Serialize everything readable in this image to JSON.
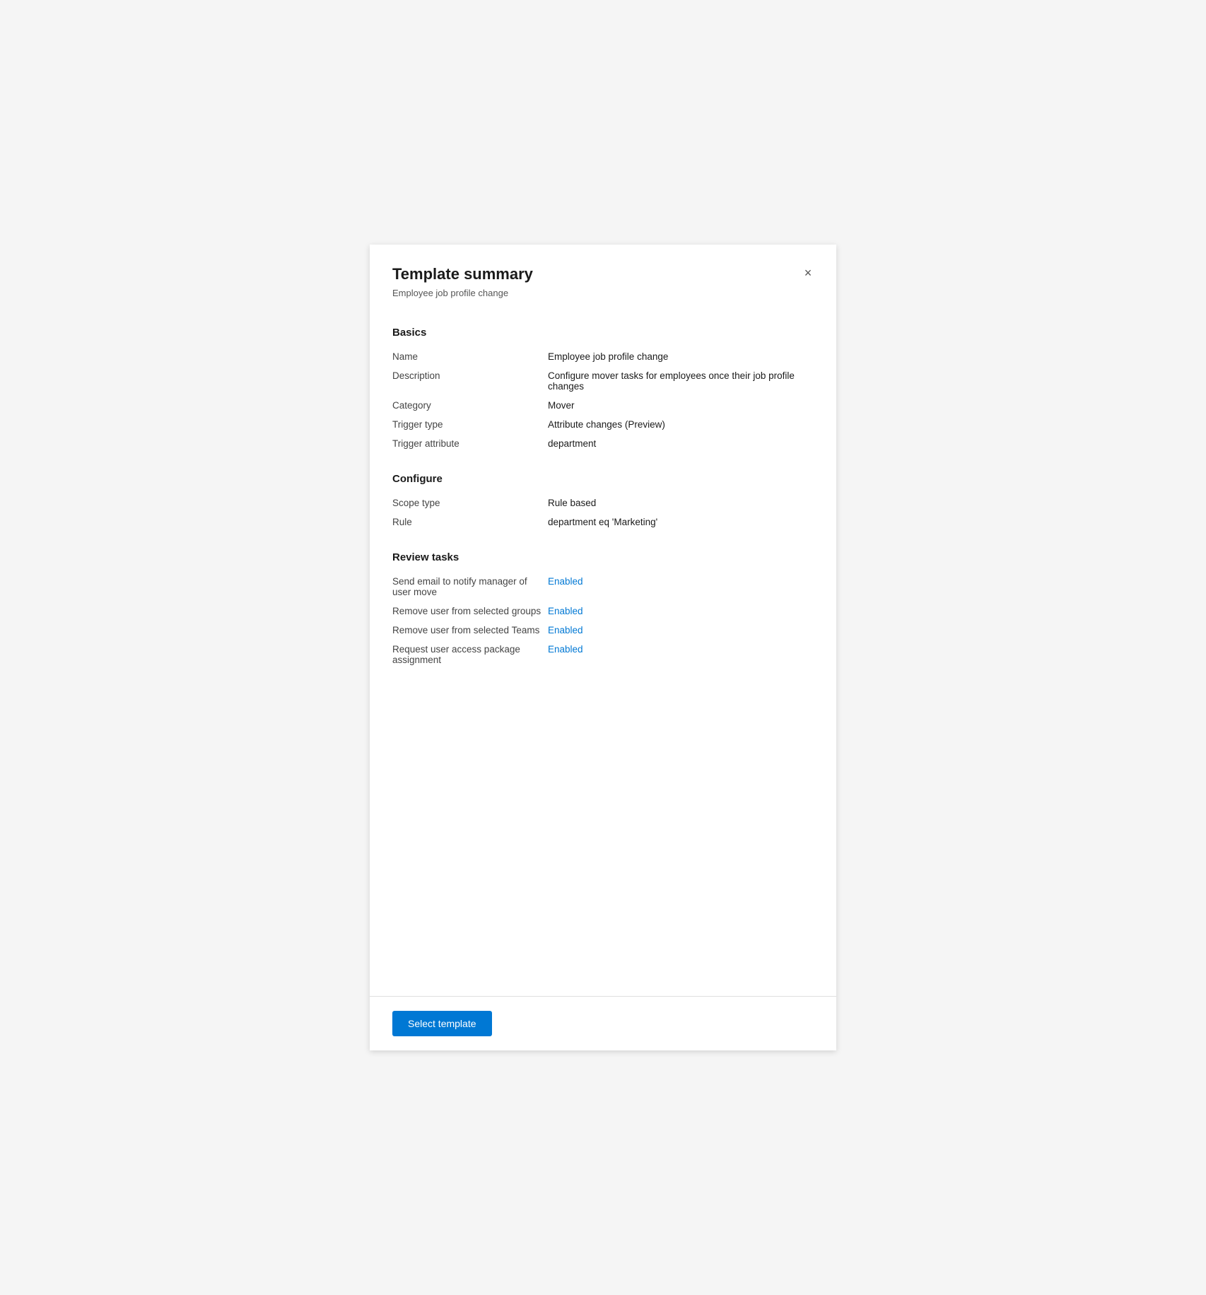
{
  "header": {
    "title": "Template summary",
    "subtitle": "Employee job profile change",
    "close_label": "×"
  },
  "sections": [
    {
      "id": "basics",
      "title": "Basics",
      "fields": [
        {
          "label": "Name",
          "value": "Employee job profile change",
          "enabled": false
        },
        {
          "label": "Description",
          "value": "Configure mover tasks for employees once their job profile changes",
          "enabled": false
        },
        {
          "label": "Category",
          "value": "Mover",
          "enabled": false
        },
        {
          "label": "Trigger type",
          "value": "Attribute changes (Preview)",
          "enabled": false
        },
        {
          "label": "Trigger attribute",
          "value": "department",
          "enabled": false
        }
      ]
    },
    {
      "id": "configure",
      "title": "Configure",
      "fields": [
        {
          "label": "Scope type",
          "value": "Rule based",
          "enabled": false
        },
        {
          "label": "Rule",
          "value": "department eq 'Marketing'",
          "enabled": false
        }
      ]
    },
    {
      "id": "review-tasks",
      "title": "Review tasks",
      "fields": [
        {
          "label": "Send email to notify manager of user move",
          "value": "Enabled",
          "enabled": true
        },
        {
          "label": "Remove user from selected groups",
          "value": "Enabled",
          "enabled": true
        },
        {
          "label": "Remove user from selected Teams",
          "value": "Enabled",
          "enabled": true
        },
        {
          "label": "Request user access package assignment",
          "value": "Enabled",
          "enabled": true
        }
      ]
    }
  ],
  "footer": {
    "select_template_label": "Select template"
  }
}
